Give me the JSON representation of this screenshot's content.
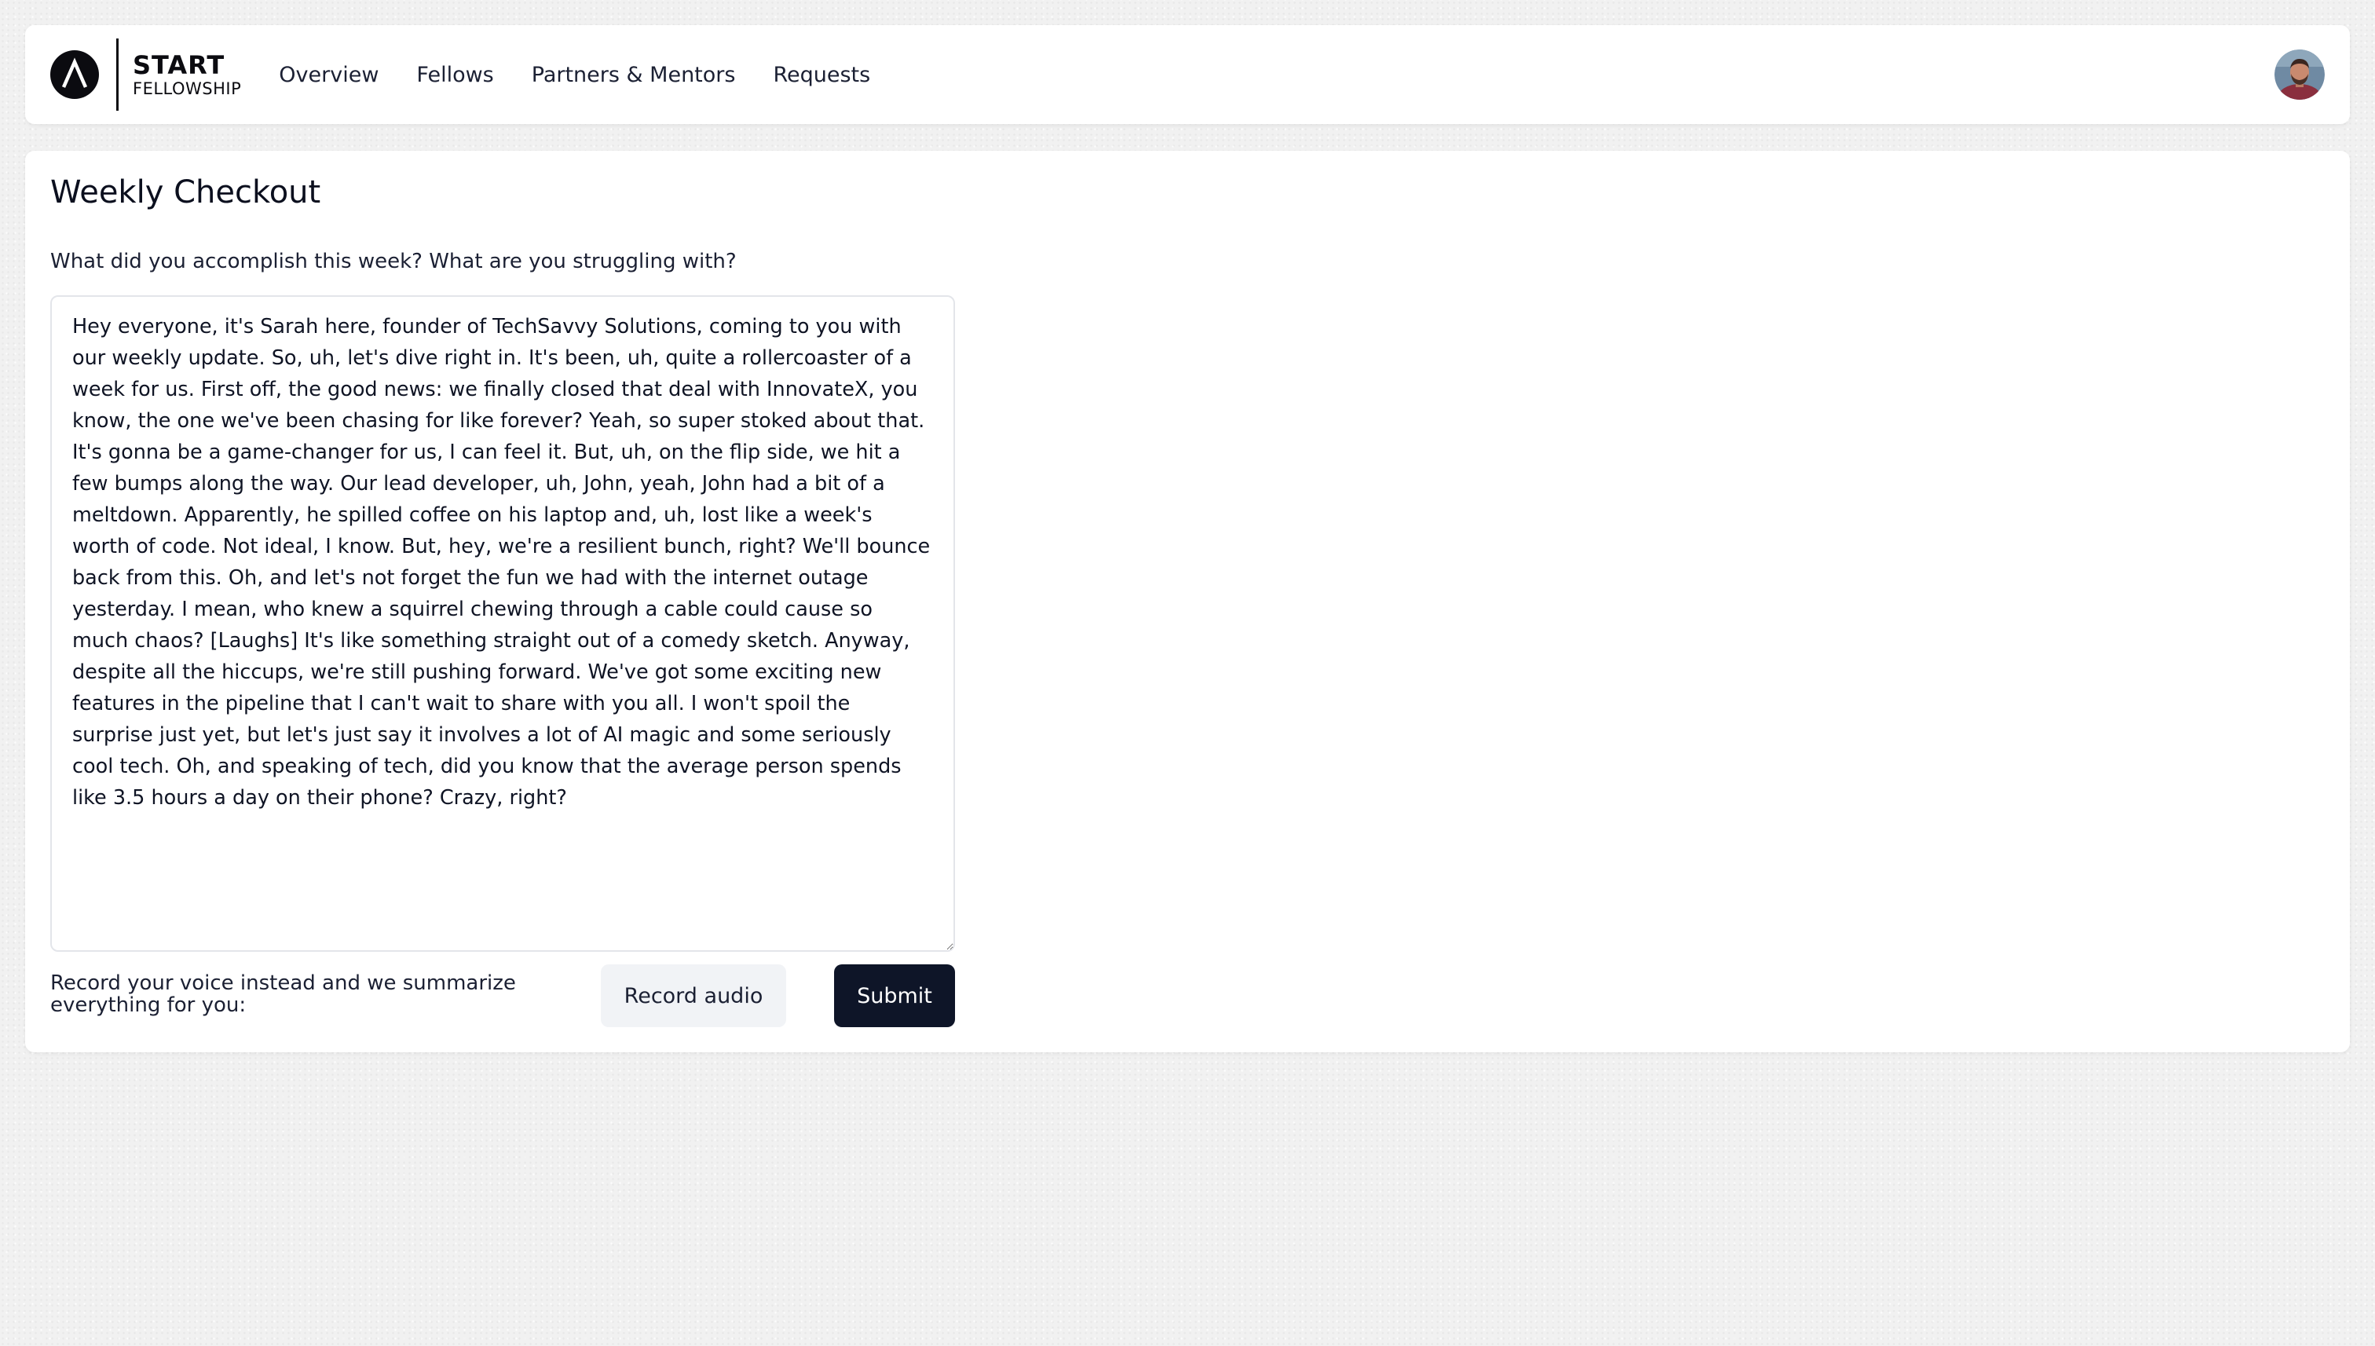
{
  "brand": {
    "name_top": "START",
    "name_bottom": "FELLOWSHIP",
    "logo_icon": "start-a-icon",
    "color": "#0b0b10"
  },
  "nav": {
    "items": [
      {
        "label": "Overview"
      },
      {
        "label": "Fellows"
      },
      {
        "label": "Partners & Mentors"
      },
      {
        "label": "Requests"
      }
    ]
  },
  "user": {
    "avatar_icon": "user-avatar"
  },
  "checkout": {
    "title": "Weekly Checkout",
    "prompt": "What did you accomplish this week? What are you struggling with?",
    "text": "Hey everyone, it's Sarah here, founder of TechSavvy Solutions, coming to you with our weekly update. So, uh, let's dive right in. It's been, uh, quite a rollercoaster of a week for us. First off, the good news: we finally closed that deal with InnovateX, you know, the one we've been chasing for like forever? Yeah, so super stoked about that. It's gonna be a game-changer for us, I can feel it. But, uh, on the flip side, we hit a few bumps along the way. Our lead developer, uh, John, yeah, John had a bit of a meltdown. Apparently, he spilled coffee on his laptop and, uh, lost like a week's worth of code. Not ideal, I know. But, hey, we're a resilient bunch, right? We'll bounce back from this. Oh, and let's not forget the fun we had with the internet outage yesterday. I mean, who knew a squirrel chewing through a cable could cause so much chaos? [Laughs] It's like something straight out of a comedy sketch. Anyway, despite all the hiccups, we're still pushing forward. We've got some exciting new features in the pipeline that I can't wait to share with you all. I won't spoil the surprise just yet, but let's just say it involves a lot of AI magic and some seriously cool tech. Oh, and speaking of tech, did you know that the average person spends like 3.5 hours a day on their phone? Crazy, right?",
    "record_label": "Record your voice instead and we summarize everything for you:",
    "record_button": "Record audio",
    "submit_button": "Submit"
  },
  "colors": {
    "page_background": "#f1f1f1",
    "primary_button": "#0e1528",
    "secondary_button": "#f1f3f6",
    "text": "#1b2033"
  }
}
